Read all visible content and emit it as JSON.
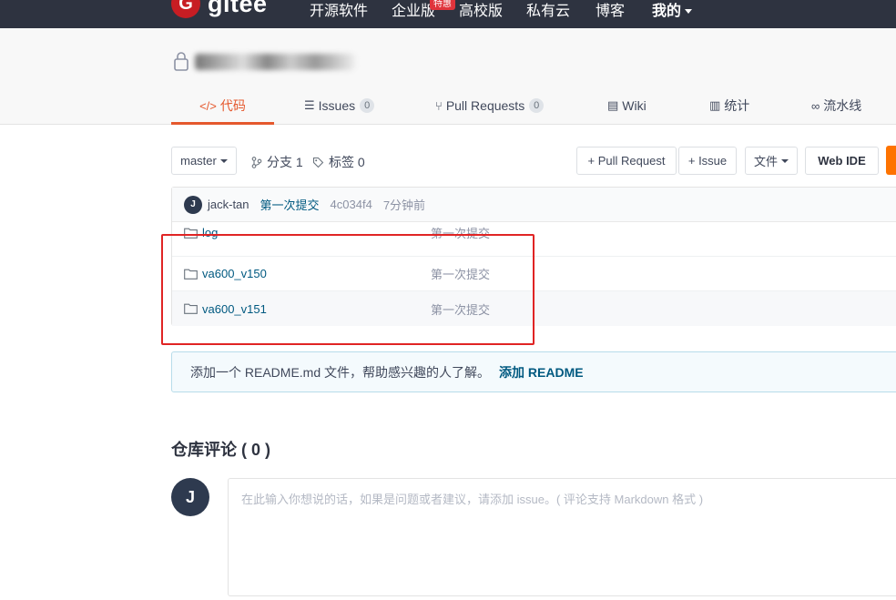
{
  "nav": {
    "logo_letter": "G",
    "logo_text": "gitee",
    "items": [
      {
        "label": "开源软件"
      },
      {
        "label": "企业版"
      },
      {
        "label": "高校版"
      },
      {
        "label": "私有云"
      },
      {
        "label": "博客"
      },
      {
        "label": "我的"
      }
    ],
    "hot_badge": "特惠"
  },
  "tabs": [
    {
      "icon": "</>",
      "label": "代码"
    },
    {
      "icon": "☰",
      "label": "Issues",
      "count": "0"
    },
    {
      "icon": "⑂",
      "label": "Pull Requests",
      "count": "0"
    },
    {
      "icon": "▤",
      "label": "Wiki"
    },
    {
      "icon": "▥",
      "label": "统计"
    },
    {
      "icon": "∞",
      "label": "流水线"
    }
  ],
  "toolbar": {
    "branch": "master",
    "branches": "分支 1",
    "tags": "标签 0",
    "pull_request": "+ Pull Request",
    "issue": "+ Issue",
    "files": "文件",
    "web_ide": "Web IDE"
  },
  "commit": {
    "avatar": "J",
    "author": "jack-tan",
    "message": "第一次提交",
    "sha": "4c034f4",
    "time": "7分钟前"
  },
  "files": [
    {
      "name": "log",
      "commit": "第一次提交"
    },
    {
      "name": "va600_v150",
      "commit": "第一次提交"
    },
    {
      "name": "va600_v151",
      "commit": "第一次提交"
    }
  ],
  "readme": {
    "text": "添加一个 README.md 文件，帮助感兴趣的人了解。",
    "link": "添加 README"
  },
  "comments": {
    "title": "仓库评论 ( 0 )",
    "avatar": "J",
    "placeholder": "在此输入你想说的话，如果是问题或者建议，请添加 issue。( 评论支持 Markdown 格式 )"
  },
  "colors": {
    "accent": "#e5582d",
    "nav_bg": "#2e3340",
    "link": "#005980",
    "highlight": "#e02424"
  }
}
